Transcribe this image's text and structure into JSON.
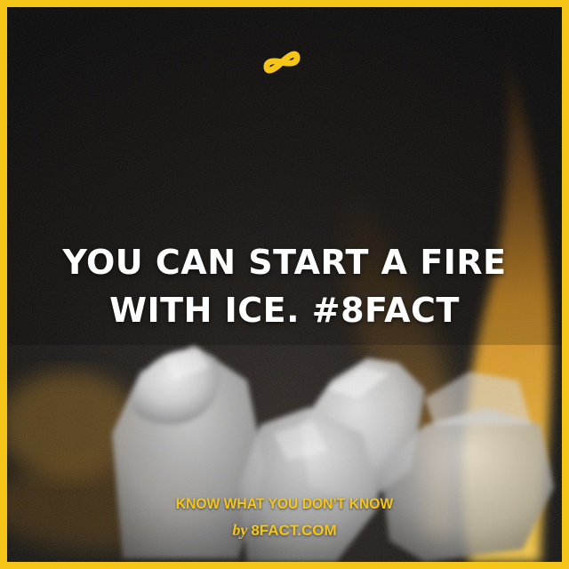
{
  "brand": {
    "logo_icon": "infinity-8-logo-icon",
    "accent_color": "#f5c518"
  },
  "headline": {
    "line1": "YOU CAN START A FIRE",
    "line2": "WITH ICE. #8FACT"
  },
  "footer": {
    "tagline": "KNOW WHAT YOU DON’T KNOW",
    "by": "by",
    "site": "8FACT.COM"
  },
  "background": {
    "subject": "ice-cubes-with-flames"
  }
}
